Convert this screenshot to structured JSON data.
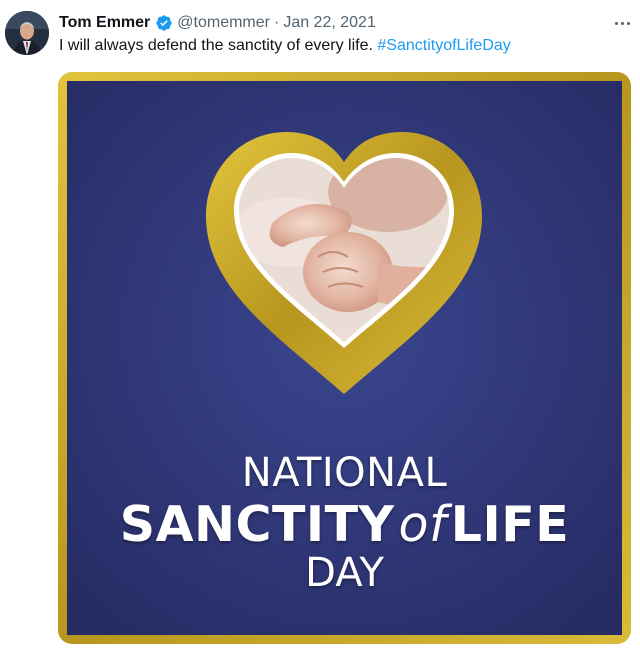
{
  "tweet": {
    "author_name": "Tom Emmer",
    "handle": "@tomemmer",
    "separator": "·",
    "date": "Jan 22, 2021",
    "text": "I will always defend the sanctity of every life.",
    "hashtag": "#SanctityofLifeDay"
  },
  "media": {
    "line1": "NATIONAL",
    "line2_a": "SANCTITY",
    "line2_of": "of",
    "line2_b": "LIFE",
    "line3": "DAY"
  },
  "colors": {
    "verified": "#1d9bf0",
    "hashtag": "#1d9bf0",
    "gold_frame": "#c2a22a",
    "navy_background": "#2e3575"
  },
  "icons": {
    "verified": "verified-badge-icon",
    "more": "more-options-icon"
  }
}
